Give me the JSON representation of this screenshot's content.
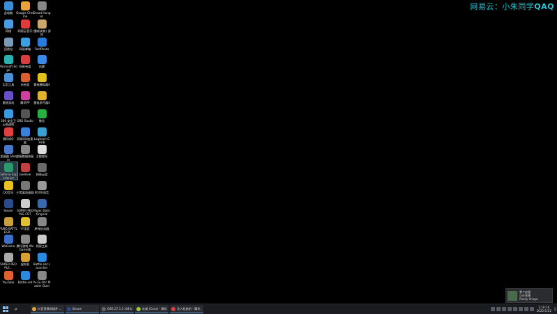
{
  "watermark": {
    "cn": "网易云：小朱同学",
    "latin": "QAQ"
  },
  "desktop_icons": [
    {
      "label": "此电脑",
      "color": "#3b8fd6"
    },
    {
      "label": "Google Chrome",
      "color": "#e8a33b"
    },
    {
      "label": "Dread Hunger",
      "color": "#888"
    },
    {
      "label": "网络",
      "color": "#4a9be0"
    },
    {
      "label": "网易云音乐",
      "color": "#e03a3a"
    },
    {
      "label": "(重新安装) 游戏",
      "color": "#c8a86b"
    },
    {
      "label": "回收站",
      "color": "#7a9ab8"
    },
    {
      "label": "网易邮箱",
      "color": "#3aa0e0"
    },
    {
      "label": "FastPhoto",
      "color": "#2a7ad8"
    },
    {
      "label": "Microsoft Edge",
      "color": "#2ab0b0"
    },
    {
      "label": "网易有道",
      "color": "#d84040"
    },
    {
      "label": "迅雷",
      "color": "#3a8ae8"
    },
    {
      "label": "实用工具",
      "color": "#4a90d8"
    },
    {
      "label": "米哈游",
      "color": "#d86030"
    },
    {
      "label": "雷电模拟器4",
      "color": "#e0c020"
    },
    {
      "label": "惠普游戏",
      "color": "#6a50c8"
    },
    {
      "label": "腾讯PP",
      "color": "#d040a0"
    },
    {
      "label": "雷电多开器4",
      "color": "#e0b030"
    },
    {
      "label": "360 安全卫士极速版",
      "color": "#3a9ae0"
    },
    {
      "label": "OBS Studio",
      "color": "#555"
    },
    {
      "label": "微信",
      "color": "#2ab040"
    },
    {
      "label": "腾讯QQ",
      "color": "#e04040"
    },
    {
      "label": "网易UU加速器",
      "color": "#3a80d8"
    },
    {
      "label": "Logitech G HUB",
      "color": "#3aa0d0"
    },
    {
      "label": "加速器 Steam",
      "color": "#4a78c8"
    },
    {
      "label": "超级数据恢复",
      "color": "#888"
    },
    {
      "label": "主题壁纸",
      "color": "#ddd"
    },
    {
      "label": "Geforce Experience",
      "color": "#2a9a6a"
    },
    {
      "label": "GeeGee",
      "color": "#c04040"
    },
    {
      "label": "网易云游",
      "color": "#6a6a6a"
    },
    {
      "label": "QQ音乐",
      "color": "#e8c020"
    },
    {
      "label": "小黑盒加速器",
      "color": "#777"
    },
    {
      "label": "KOOK语音",
      "color": "#999"
    },
    {
      "label": "Steam",
      "color": "#2a4a8a"
    },
    {
      "label": "SUPER PEOPLE CBT",
      "color": "#ccc"
    },
    {
      "label": "Paper Dolls Original",
      "color": "#3a6aa8"
    },
    {
      "label": "PUBG BATTLEGR...",
      "color": "#c8a040"
    },
    {
      "label": "YY语音",
      "color": "#e0c030"
    },
    {
      "label": "原神启动器",
      "color": "#888"
    },
    {
      "label": "WeGame",
      "color": "#3a70c8"
    },
    {
      "label": "腾讯游戏 WeGame版",
      "color": "#888"
    },
    {
      "label": "网易工具",
      "color": "#ccc"
    },
    {
      "label": "SUPER PEOPLE...",
      "color": "#aaa"
    },
    {
      "label": "虚拟机",
      "color": "#d8a030"
    },
    {
      "label": "Battle.net Launcher",
      "color": "#2a8ae0"
    },
    {
      "label": "YouTube",
      "color": "#e06030"
    },
    {
      "label": "Battle.net",
      "color": "#2a8ae0"
    },
    {
      "label": "Yu-Gi-Oh! Master Duel",
      "color": "#888"
    }
  ],
  "taskbar": {
    "apps": [
      {
        "label": "抖音直播间插件 ...",
        "color": "#e8a33b"
      },
      {
        "label": "Steam",
        "color": "#2a4a8a"
      },
      {
        "label": "OBS 27.1.3 (64-bit...",
        "color": "#666"
      },
      {
        "label": "花椒 (Cons) - 腾讯...",
        "color": "#9ad030"
      },
      {
        "label": "无人机航拍 - 腾讯...",
        "color": "#e04040"
      }
    ],
    "clock_time": "1:10:16",
    "clock_date": "2022/1/22"
  },
  "notification": {
    "title": "蒙个皮猫",
    "line1": "正在直播",
    "line2": "Ready Image"
  }
}
